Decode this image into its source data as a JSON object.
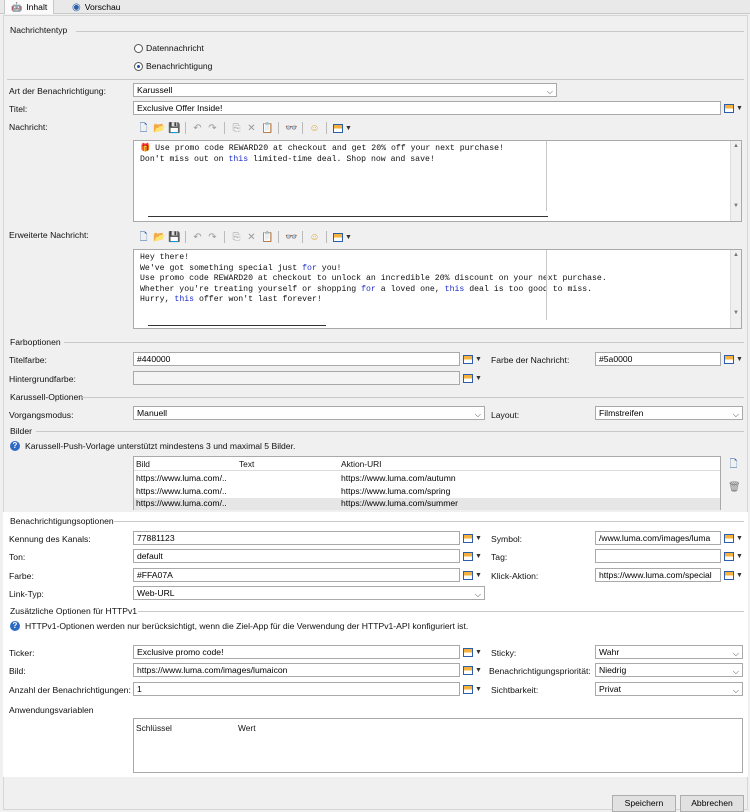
{
  "tabs": [
    {
      "label": "Inhalt"
    },
    {
      "label": "Vorschau"
    }
  ],
  "nachrichtentyp": {
    "title": "Nachrichtentyp",
    "options": [
      {
        "label": "Datennachricht",
        "selected": false
      },
      {
        "label": "Benachrichtigung",
        "selected": true
      }
    ]
  },
  "art": {
    "label": "Art der Benachrichtigung:",
    "value": "Karussell"
  },
  "titel": {
    "label": "Titel:",
    "value": "Exclusive Offer Inside!"
  },
  "nachricht": {
    "label": "Nachricht:",
    "lines": [
      [
        [
          "🎁 Use promo code REWARD20 at checkout and get 20% off your next purchase!",
          ""
        ]
      ],
      [
        [
          "Don't miss out on ",
          ""
        ],
        [
          "this",
          "kw"
        ],
        [
          " limited-time deal. Shop now and save!",
          ""
        ]
      ]
    ]
  },
  "erweitert": {
    "label": "Erweiterte Nachricht:",
    "lines": [
      [
        [
          "Hey there!",
          ""
        ]
      ],
      [
        [
          "We've got something special just ",
          ""
        ],
        [
          "for",
          "kw"
        ],
        [
          " you!",
          ""
        ]
      ],
      [
        [
          "Use promo code REWARD20 at checkout to unlock an incredible 20% discount on your next purchase.",
          ""
        ]
      ],
      [
        [
          "Whether you're treating yourself or shopping ",
          ""
        ],
        [
          "for",
          "kw"
        ],
        [
          " a loved one, ",
          ""
        ],
        [
          "this",
          "kw"
        ],
        [
          " deal is too good to miss.",
          ""
        ]
      ],
      [
        [
          "Hurry, ",
          ""
        ],
        [
          "this",
          "kw"
        ],
        [
          " offer won't last forever!",
          ""
        ]
      ]
    ]
  },
  "farboptionen": {
    "title": "Farboptionen",
    "titelfarbe_label": "Titelfarbe:",
    "titelfarbe": "#440000",
    "farbe_nachricht_label": "Farbe der Nachricht:",
    "farbe_nachricht": "#5a0000",
    "hintergrund_label": "Hintergrundfarbe:",
    "hintergrund": ""
  },
  "karussell": {
    "title": "Karussell-Optionen",
    "vorgang_label": "Vorgangsmodus:",
    "vorgang": "Manuell",
    "layout_label": "Layout:",
    "layout": "Filmstreifen"
  },
  "bilder": {
    "title": "Bilder",
    "info": "Karussell-Push-Vorlage unterstützt mindestens 3 und maximal 5 Bilder.",
    "columns": [
      "Bild",
      "Text",
      "Aktion-URI"
    ],
    "rows": [
      [
        "https://www.luma.com/..",
        "",
        "https://www.luma.com/autumn"
      ],
      [
        "https://www.luma.com/..",
        "",
        "https://www.luma.com/spring"
      ],
      [
        "https://www.luma.com/..",
        "",
        "https://www.luma.com/summer"
      ]
    ]
  },
  "benachrichtigung": {
    "title": "Benachrichtigungsoptionen",
    "kanal_label": "Kennung des Kanals:",
    "kanal": "77881123",
    "symbol_label": "Symbol:",
    "symbol": "/www.luma.com/images/luma",
    "ton_label": "Ton:",
    "ton": "default",
    "tag_label": "Tag:",
    "tag": "",
    "farbe_label": "Farbe:",
    "farbe": "#FFA07A",
    "klick_label": "Klick-Aktion:",
    "klick": "https://www.luma.com/special",
    "link_label": "Link-Typ:",
    "link": "Web-URL"
  },
  "httpv1": {
    "title": "Zusätzliche Optionen für HTTPv1",
    "info": "HTTPv1-Optionen werden nur berücksichtigt, wenn die Ziel-App für die Verwendung der HTTPv1-API konfiguriert ist.",
    "ticker_label": "Ticker:",
    "ticker": "Exclusive promo code!",
    "sticky_label": "Sticky:",
    "sticky": "Wahr",
    "bild_label": "Bild:",
    "bild": "https://www.luma.com/images/lumaicon",
    "prio_label": "Benachrichtigungspriorität:",
    "prio": "Niedrig",
    "anzahl_label": "Anzahl der Benachrichtigungen:",
    "anzahl": "1",
    "sicht_label": "Sichtbarkeit:",
    "sicht": "Privat"
  },
  "anwendung": {
    "title": "Anwendungsvariablen",
    "columns": [
      "Schlüssel",
      "Wert"
    ]
  },
  "buttons": {
    "ok": "Speichern",
    "cancel": "Abbrechen"
  },
  "icons": [
    "android-icon",
    "eye-icon",
    "new-file-icon",
    "open-folder-icon",
    "save-icon",
    "undo-icon",
    "redo-icon",
    "copy-icon",
    "cut-icon",
    "paste-icon",
    "find-icon",
    "emoji-icon",
    "personalize-icon",
    "info-icon",
    "trash-icon",
    "color-picker-icon"
  ]
}
